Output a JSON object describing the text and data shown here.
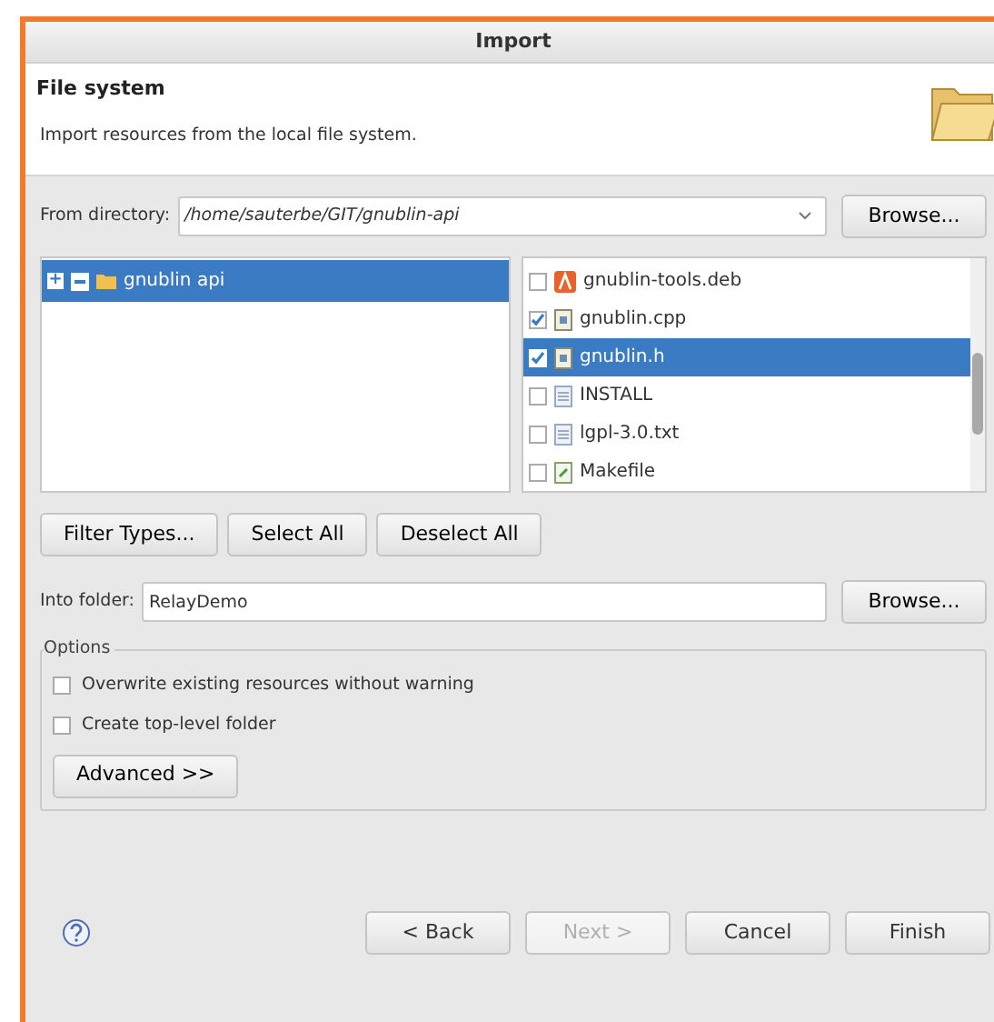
{
  "window": {
    "title": "Import"
  },
  "header": {
    "title": "File system",
    "description": "Import resources from the local file system."
  },
  "from_directory": {
    "label": "From directory:",
    "value": "/home/sauterbe/GIT/gnublin-api",
    "browse": "Browse..."
  },
  "folder_tree": [
    {
      "label": "gnublin api",
      "expand": "+",
      "checked": true,
      "partial": true,
      "selected": true
    }
  ],
  "files": [
    {
      "name": "gnublin-tools.deb",
      "kind": "package",
      "checked": false,
      "selected": false
    },
    {
      "name": "gnublin.cpp",
      "kind": "source",
      "checked": true,
      "selected": false
    },
    {
      "name": "gnublin.h",
      "kind": "source",
      "checked": true,
      "selected": true
    },
    {
      "name": "INSTALL",
      "kind": "text",
      "checked": false,
      "selected": false
    },
    {
      "name": "lgpl-3.0.txt",
      "kind": "text",
      "checked": false,
      "selected": false
    },
    {
      "name": "Makefile",
      "kind": "script",
      "checked": false,
      "selected": false
    }
  ],
  "selection_buttons": [
    "Filter Types...",
    "Select All",
    "Deselect All"
  ],
  "into_folder": {
    "label": "Into folder:",
    "value": "RelayDemo",
    "browse": "Browse..."
  },
  "options": {
    "title": "Options",
    "items": [
      {
        "label": "Overwrite existing resources without warning",
        "checked": false
      },
      {
        "label": "Create top-level folder",
        "checked": false
      }
    ],
    "advanced": "Advanced >>"
  },
  "footer": {
    "buttons": [
      {
        "label": "< Back",
        "disabled": false
      },
      {
        "label": "Next >",
        "disabled": true
      },
      {
        "label": "Cancel",
        "disabled": false
      },
      {
        "label": "Finish",
        "disabled": false
      }
    ]
  }
}
